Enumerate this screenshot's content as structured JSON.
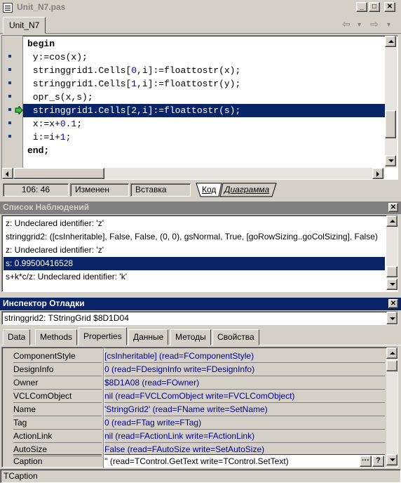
{
  "window": {
    "title": "Unit_N7.pas",
    "minimize_label": "_",
    "maximize_label": "□",
    "close_label": "✕"
  },
  "editor_tabs": [
    "Unit_N7"
  ],
  "nav": {
    "back": "⇦",
    "back_dd": "▾",
    "forward": "⇨",
    "forward_dd": "▾"
  },
  "code_lines": [
    "begin",
    " y:=cos(x);",
    " stringgrid1.Cells[0,i]:=floattostr(x);",
    " stringgrid1.Cells[1,i]:=floattostr(y);",
    " opr_s(x,s);",
    " stringgrid1.Cells[2,i]:=floattostr(s);",
    " x:=x+0.1;",
    " i:=i+1;",
    "end;"
  ],
  "status": {
    "position": "106:  46",
    "modified": "Изменен",
    "insert": "Вставка",
    "tab_code": "Код",
    "tab_diagram": "Диаграмма"
  },
  "watch": {
    "title": "Список Наблюдений",
    "items": [
      "z: Undeclared identifier: 'z'",
      "stringgrid2: ([csInheritable], False, False, (0, 0), gsNormal, True, [goRowSizing..goColSizing], False)",
      "z: Undeclared identifier: 'z'",
      "s: 0.99500416528",
      "s+k*c/z: Undeclared identifier: 'k'"
    ],
    "selected_index": 3
  },
  "inspector": {
    "title": "Инспектор Отладки",
    "object": "stringgrid2: TStringGrid $8D1D04",
    "tabs": [
      "Data",
      "Methods",
      "Properties",
      "Данные",
      "Методы",
      "Свойства"
    ],
    "active_tab": "Properties",
    "properties": [
      {
        "name": "ComponentStyle",
        "value": "[csInheritable]  (read=FComponentStyle)"
      },
      {
        "name": "DesignInfo",
        "value": "0  (read=FDesignInfo write=FDesignInfo)"
      },
      {
        "name": "Owner",
        "value": "$8D1A08  (read=FOwner)"
      },
      {
        "name": "VCLComObject",
        "value": "nil  (read=FVCLComObject write=FVCLComObject)"
      },
      {
        "name": "Name",
        "value": "'StringGrid2'  (read=FName write=SetName)"
      },
      {
        "name": "Tag",
        "value": "0  (read=FTag write=FTag)"
      },
      {
        "name": "ActionLink",
        "value": "nil  (read=FActionLink write=FActionLink)"
      },
      {
        "name": "AutoSize",
        "value": "False  (read=FAutoSize write=SetAutoSize)"
      },
      {
        "name": "Caption",
        "value": "''  (read=TControl.GetText write=TControl.SetText)"
      }
    ],
    "ellipsis_label": "···",
    "help_label": "?",
    "status": "TCaption"
  },
  "colors": {
    "highlight": "#0a246a",
    "caption_active": "#0a246a",
    "caption_inactive": "#808080",
    "number": "#0000c0",
    "prop_value": "#00008b"
  }
}
